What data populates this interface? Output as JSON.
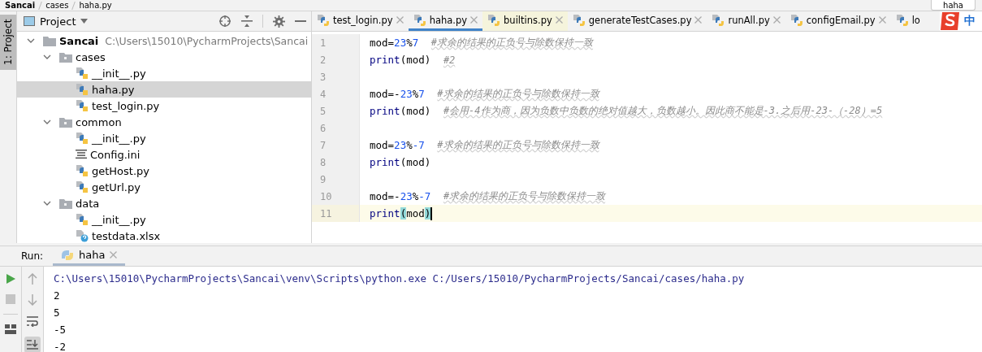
{
  "breadcrumb": [
    "Sancai",
    "cases",
    "haha.py"
  ],
  "run_config": "haha",
  "tool_window_tab": "1: Project",
  "project_panel": {
    "title": "Project",
    "tree": [
      {
        "kind": "root",
        "name": "Sancai",
        "path": "C:\\Users\\15010\\PycharmProjects\\Sancai",
        "expanded": true,
        "selected": false,
        "children": [
          {
            "kind": "folder",
            "name": "cases",
            "expanded": true,
            "selected": false,
            "children": [
              {
                "kind": "py",
                "name": "__init__.py",
                "selected": false
              },
              {
                "kind": "py",
                "name": "haha.py",
                "selected": true
              },
              {
                "kind": "py",
                "name": "test_login.py",
                "selected": false
              }
            ]
          },
          {
            "kind": "folder",
            "name": "common",
            "expanded": true,
            "selected": false,
            "children": [
              {
                "kind": "py",
                "name": "__init__.py",
                "selected": false
              },
              {
                "kind": "ini",
                "name": "Config.ini",
                "selected": false
              },
              {
                "kind": "py",
                "name": "getHost.py",
                "selected": false
              },
              {
                "kind": "py",
                "name": "getUrl.py",
                "selected": false
              }
            ]
          },
          {
            "kind": "folder",
            "name": "data",
            "expanded": true,
            "selected": false,
            "children": [
              {
                "kind": "py",
                "name": "__init__.py",
                "selected": false
              },
              {
                "kind": "xlsx",
                "name": "testdata.xlsx",
                "selected": false
              }
            ]
          }
        ]
      }
    ]
  },
  "tabs": [
    {
      "label": "test_login.py",
      "selected": false,
      "library": false,
      "closable": true
    },
    {
      "label": "haha.py",
      "selected": true,
      "library": false,
      "closable": true
    },
    {
      "label": "builtins.py",
      "selected": false,
      "library": true,
      "closable": true
    },
    {
      "label": "generateTestCases.py",
      "selected": false,
      "library": false,
      "closable": true
    },
    {
      "label": "runAll.py",
      "selected": false,
      "library": false,
      "closable": true
    },
    {
      "label": "configEmail.py",
      "selected": false,
      "library": false,
      "closable": true
    },
    {
      "label": "lo",
      "selected": false,
      "library": false,
      "closable": false
    }
  ],
  "ime": {
    "label": "中"
  },
  "code": [
    {
      "number": "1",
      "current": false,
      "tokens": [
        {
          "kind": "plain",
          "text": "mod="
        },
        {
          "kind": "number",
          "text": "23"
        },
        {
          "kind": "plain",
          "text": "%"
        },
        {
          "kind": "number",
          "text": "7"
        },
        {
          "kind": "comment",
          "text": "#求余的结果的正负号与除数保持一致"
        }
      ]
    },
    {
      "number": "2",
      "current": false,
      "tokens": [
        {
          "kind": "builtin",
          "text": "print"
        },
        {
          "kind": "plain",
          "text": "(mod)"
        },
        {
          "kind": "comment",
          "text": "#2"
        }
      ]
    },
    {
      "number": "3",
      "current": false
    },
    {
      "number": "4",
      "current": false,
      "tokens": [
        {
          "kind": "plain",
          "text": "mod=-"
        },
        {
          "kind": "number",
          "text": "23"
        },
        {
          "kind": "plain",
          "text": "%"
        },
        {
          "kind": "number",
          "text": "7"
        },
        {
          "kind": "comment",
          "text": "#求余的结果的正负号与除数保持一致"
        }
      ]
    },
    {
      "number": "5",
      "current": false,
      "tokens": [
        {
          "kind": "builtin",
          "text": "print"
        },
        {
          "kind": "plain",
          "text": "(mod)"
        },
        {
          "kind": "comment",
          "text": "#会用-4作为商，因为负数中负数的绝对值越大，负数越小。因此商不能是-3.之后用-23-（-28）=5"
        }
      ]
    },
    {
      "number": "6",
      "current": false
    },
    {
      "number": "7",
      "current": false,
      "tokens": [
        {
          "kind": "plain",
          "text": "mod="
        },
        {
          "kind": "number",
          "text": "23"
        },
        {
          "kind": "plain",
          "text": "%"
        },
        {
          "kind": "number",
          "text": "-7"
        },
        {
          "kind": "comment",
          "text": "#求余的结果的正负号与除数保持一致"
        }
      ]
    },
    {
      "number": "8",
      "current": false,
      "tokens": [
        {
          "kind": "builtin",
          "text": "print"
        },
        {
          "kind": "plain",
          "text": "(mod)"
        }
      ]
    },
    {
      "number": "9",
      "current": false
    },
    {
      "number": "10",
      "current": false,
      "tokens": [
        {
          "kind": "plain",
          "text": "mod=-"
        },
        {
          "kind": "number",
          "text": "23"
        },
        {
          "kind": "plain",
          "text": "%"
        },
        {
          "kind": "number",
          "text": "-7"
        },
        {
          "kind": "comment",
          "text": "#求余的结果的正负号与除数保持一致"
        }
      ]
    },
    {
      "number": "11",
      "current": true,
      "tokens": [
        {
          "kind": "builtin",
          "text": "print"
        },
        {
          "kind": "brace",
          "text": "("
        },
        {
          "kind": "plain",
          "text": "mod"
        },
        {
          "kind": "brace",
          "text": ")"
        }
      ]
    }
  ],
  "run_panel": {
    "label": "Run:",
    "tab": "haha",
    "output": [
      {
        "kind": "command",
        "text": "C:\\Users\\15010\\PycharmProjects\\Sancai\\venv\\Scripts\\python.exe C:/Users/15010/PycharmProjects/Sancai/cases/haha.py"
      },
      {
        "kind": "stdout",
        "text": "2"
      },
      {
        "kind": "stdout",
        "text": "5"
      },
      {
        "kind": "stdout",
        "text": "-5"
      },
      {
        "kind": "stdout",
        "text": "-2"
      }
    ]
  }
}
